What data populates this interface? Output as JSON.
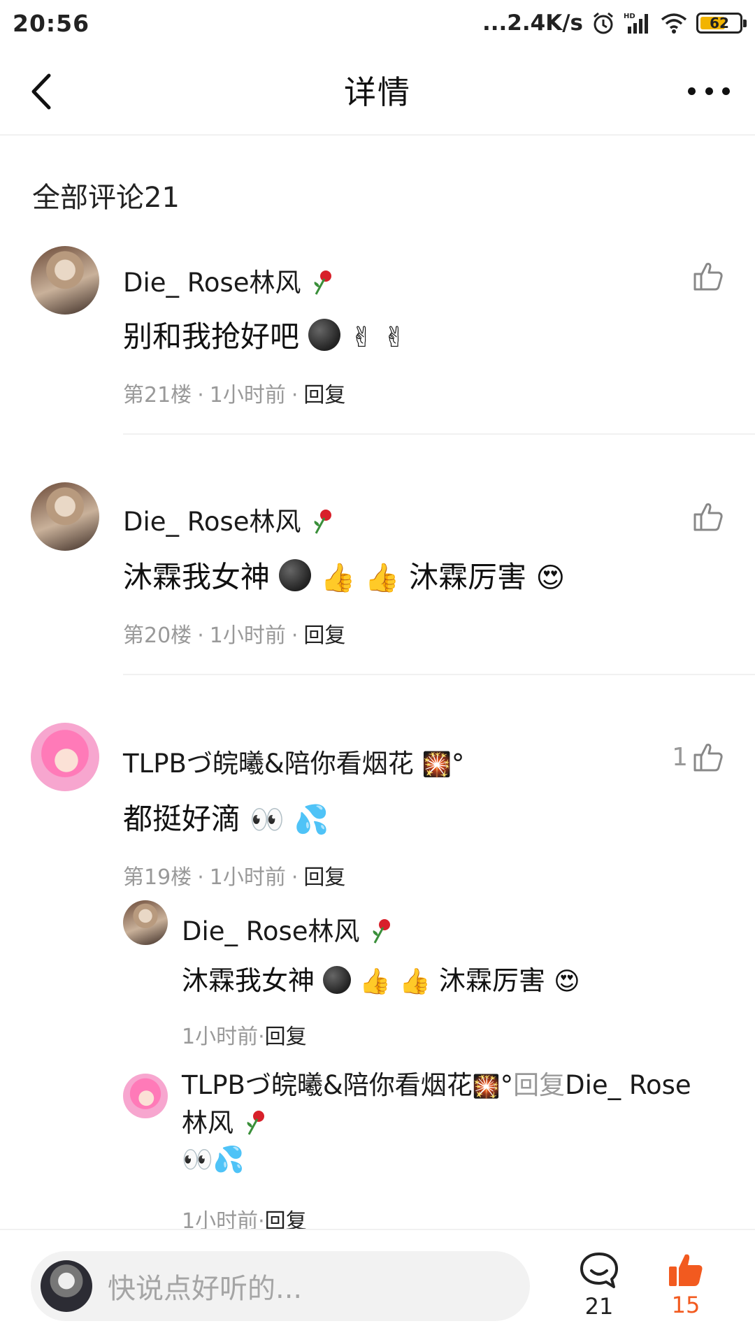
{
  "status": {
    "time": "20:56",
    "speed": "...2.4K/s",
    "battery": "62"
  },
  "nav": {
    "title": "详情"
  },
  "section_title": "全部评论21",
  "comments": [
    {
      "name": "Die_ Rose林风",
      "text": "别和我抢好吧",
      "emoji": [
        "dark-face",
        "victory-hand",
        "victory-hand"
      ],
      "floor": "第21楼",
      "time": "1小时前",
      "reply": "回复",
      "likes": ""
    },
    {
      "name": "Die_ Rose林风",
      "text_a": "沐霖我女神",
      "text_b": "沐霖厉害",
      "floor": "第20楼",
      "time": "1小时前",
      "reply": "回复",
      "likes": ""
    },
    {
      "name": "TLPBづ皖曦&陪你看烟花",
      "name_suffix": "°",
      "text": "都挺好滴",
      "floor": "第19楼",
      "time": "1小时前",
      "reply": "回复",
      "likes": "1"
    }
  ],
  "replies": [
    {
      "name": "Die_ Rose林风",
      "text_a": "沐霖我女神",
      "text_b": "沐霖厉害",
      "time": "1小时前",
      "reply": "回复"
    },
    {
      "name": "TLPBづ皖曦&陪你看烟花",
      "name_suffix": "°",
      "reply_word": "回复",
      "target_a": "Die_ Rose",
      "target_b": "林风",
      "time": "1小时前",
      "reply": "回复"
    }
  ],
  "bottom": {
    "placeholder": "快说点好听的...",
    "comments": "21",
    "likes": "15"
  },
  "colors": {
    "accent": "#f25a1f",
    "meta": "#999999"
  }
}
